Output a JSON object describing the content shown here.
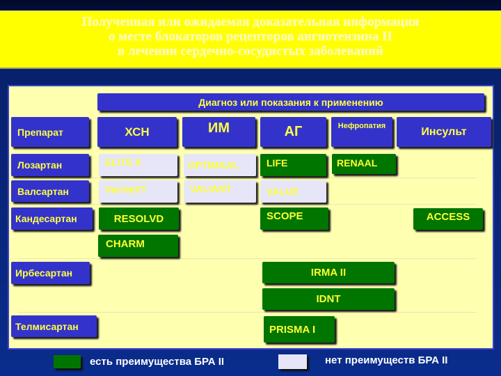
{
  "title": {
    "lines": [
      "Полученная или ожидаемая доказательная информация",
      "о месте блокаторов рецепторов ангиотензина II",
      "в лечении сердечно-сосудистых заболеваний"
    ]
  },
  "table": {
    "header_span": "Диагноз или показания к применению",
    "corner": "Препарат",
    "columns": [
      "ХСН",
      "ИМ",
      "АГ",
      "Нефропатия",
      "Инсульт"
    ],
    "rows": [
      {
        "drug": "Лозартан",
        "trials": [
          {
            "name": "ELITE II",
            "column": "ХСН",
            "benefit": false
          },
          {
            "name": "OPTIMAAL",
            "column": "ИМ",
            "benefit": false
          },
          {
            "name": "LIFE",
            "column": "АГ",
            "benefit": true
          },
          {
            "name": "RENAAL",
            "column": "Нефропатия",
            "benefit": true
          }
        ]
      },
      {
        "drug": "Валсартан",
        "trials": [
          {
            "name": "Val-HeFT",
            "column": "ХСН",
            "benefit": false
          },
          {
            "name": "VALIANT",
            "column": "ИМ",
            "benefit": false
          },
          {
            "name": "VALUE",
            "column": "АГ",
            "benefit": false
          }
        ]
      },
      {
        "drug": "Кандесартан",
        "trials": [
          {
            "name": "RESOLVD",
            "column": "ХСН",
            "benefit": true
          },
          {
            "name": "CHARM",
            "column": "ХСН",
            "benefit": true
          },
          {
            "name": "SCOPE",
            "column": "АГ",
            "benefit": true
          },
          {
            "name": "ACCESS",
            "column": "Инсульт",
            "benefit": true
          }
        ]
      },
      {
        "drug": "Ирбесартан",
        "trials": [
          {
            "name": "IRMA II",
            "column": "АГ/Нефропатия",
            "benefit": true
          },
          {
            "name": "IDNT",
            "column": "АГ/Нефропатия",
            "benefit": true
          }
        ]
      },
      {
        "drug": "Телмисартан",
        "trials": [
          {
            "name": "PRISMA I",
            "column": "АГ",
            "benefit": true
          }
        ]
      }
    ]
  },
  "legend": {
    "benefit": {
      "label": "есть преимущества БРА II",
      "color": "#007500"
    },
    "no_benefit": {
      "label": "нет преимуществ БРА II",
      "color": "#e6e6f8"
    }
  }
}
